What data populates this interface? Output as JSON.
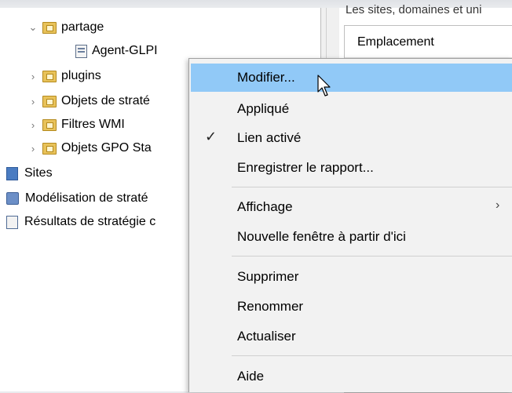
{
  "tree": {
    "items": [
      {
        "label": "partage"
      },
      {
        "label": "Agent-GLPI"
      },
      {
        "label": "plugins"
      },
      {
        "label": "Objets de straté"
      },
      {
        "label": "Filtres WMI"
      },
      {
        "label": "Objets GPO Sta"
      },
      {
        "label": "Sites"
      },
      {
        "label": "Modélisation de straté"
      },
      {
        "label": "Résultats de stratégie c"
      }
    ]
  },
  "right_panel": {
    "header_text": "Les sites, domaines et uni",
    "column_header": "Emplacement"
  },
  "context_menu": {
    "items": [
      {
        "label": "Modifier...",
        "hover": true
      },
      {
        "label": "Appliqué"
      },
      {
        "label": "Lien activé",
        "checked": true
      },
      {
        "label": "Enregistrer le rapport..."
      },
      {
        "label": "Affichage",
        "submenu": true
      },
      {
        "label": "Nouvelle fenêtre à partir d'ici"
      },
      {
        "label": "Supprimer"
      },
      {
        "label": "Renommer"
      },
      {
        "label": "Actualiser"
      },
      {
        "label": "Aide"
      }
    ],
    "check_glyph": "✓",
    "submenu_glyph": "›",
    "hover_color": "#91c9f7"
  },
  "icons": {
    "expand": "chevron-down-icon",
    "collapse": "chevron-right-icon",
    "folder": "folder-icon",
    "gpo": "gpo-icon",
    "cursor": "mouse-pointer-icon"
  }
}
